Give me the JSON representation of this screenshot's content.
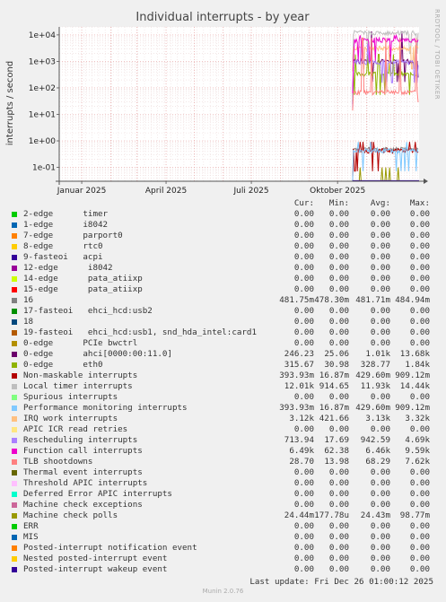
{
  "chart_data": {
    "type": "line",
    "title": "Individual interrupts - by year",
    "ylabel": "interrupts / second",
    "yscale": "log",
    "ylim": [
      0.03,
      20000
    ],
    "yticks": [
      "1e+04",
      "1e+03",
      "1e+02",
      "1e+01",
      "1e+00",
      "1e-01"
    ],
    "xlim": [
      "2024-12-08",
      "2025-12-27"
    ],
    "xticks": [
      {
        "label": "Januar 2025",
        "date": "2025-01-01"
      },
      {
        "label": "April 2025",
        "date": "2025-04-01"
      },
      {
        "label": "Juli 2025",
        "date": "2025-07-01"
      },
      {
        "label": "Oktober 2025",
        "date": "2025-10-01"
      }
    ],
    "grid": true,
    "legend": "bottom",
    "series_data_start": "2025-10-17",
    "series": [
      {
        "name": "2-edge      timer",
        "color": "#00cc00",
        "cur": "0.00",
        "min": "0.00",
        "avg": "0.00",
        "max": "0.00"
      },
      {
        "name": "1-edge      i8042",
        "color": "#0066b3",
        "cur": "0.00",
        "min": "0.00",
        "avg": "0.00",
        "max": "0.00"
      },
      {
        "name": "7-edge      parport0",
        "color": "#ff8000",
        "cur": "0.00",
        "min": "0.00",
        "avg": "0.00",
        "max": "0.00"
      },
      {
        "name": "8-edge      rtc0",
        "color": "#ffcc00",
        "cur": "0.00",
        "min": "0.00",
        "avg": "0.00",
        "max": "0.00"
      },
      {
        "name": "9-fasteoi   acpi",
        "color": "#330099",
        "cur": "0.00",
        "min": "0.00",
        "avg": "0.00",
        "max": "0.00"
      },
      {
        "name": "12-edge      i8042",
        "color": "#990099",
        "cur": "0.00",
        "min": "0.00",
        "avg": "0.00",
        "max": "0.00"
      },
      {
        "name": "14-edge      pata_atiixp",
        "color": "#ccff00",
        "cur": "0.00",
        "min": "0.00",
        "avg": "0.00",
        "max": "0.00"
      },
      {
        "name": "15-edge      pata_atiixp",
        "color": "#ff0000",
        "cur": "0.00",
        "min": "0.00",
        "avg": "0.00",
        "max": "0.00"
      },
      {
        "name": "16",
        "color": "#808080",
        "cur": "481.75m",
        "min": "478.30m",
        "avg": "481.71m",
        "max": "484.94m"
      },
      {
        "name": "17-fasteoi   ehci_hcd:usb2",
        "color": "#008f00",
        "cur": "0.00",
        "min": "0.00",
        "avg": "0.00",
        "max": "0.00"
      },
      {
        "name": "18",
        "color": "#00487d",
        "cur": "0.00",
        "min": "0.00",
        "avg": "0.00",
        "max": "0.00"
      },
      {
        "name": "19-fasteoi   ehci_hcd:usb1, snd_hda_intel:card1",
        "color": "#b35a00",
        "cur": "0.00",
        "min": "0.00",
        "avg": "0.00",
        "max": "0.00"
      },
      {
        "name": "0-edge      PCIe bwctrl",
        "color": "#b38f00",
        "cur": "0.00",
        "min": "0.00",
        "avg": "0.00",
        "max": "0.00"
      },
      {
        "name": "0-edge      ahci[0000:00:11.0]",
        "color": "#6b006b",
        "cur": "246.23",
        "min": "25.06",
        "avg": "1.01k",
        "max": "13.68k"
      },
      {
        "name": "0-edge      eth0",
        "color": "#8fb300",
        "cur": "315.67",
        "min": "30.98",
        "avg": "328.77",
        "max": "1.84k"
      },
      {
        "name": "Non-maskable interrupts",
        "color": "#b30000",
        "cur": "393.93m",
        "min": "16.87m",
        "avg": "429.60m",
        "max": "909.12m"
      },
      {
        "name": "Local timer interrupts",
        "color": "#bebebe",
        "cur": "12.01k",
        "min": "914.65",
        "avg": "11.93k",
        "max": "14.44k"
      },
      {
        "name": "Spurious interrupts",
        "color": "#80ff80",
        "cur": "0.00",
        "min": "0.00",
        "avg": "0.00",
        "max": "0.00"
      },
      {
        "name": "Performance monitoring interrupts",
        "color": "#80c9ff",
        "cur": "393.93m",
        "min": "16.87m",
        "avg": "429.60m",
        "max": "909.12m"
      },
      {
        "name": "IRQ work interrupts",
        "color": "#ffc080",
        "cur": "3.12k",
        "min": "421.66",
        "avg": "3.13k",
        "max": "3.32k"
      },
      {
        "name": "APIC ICR read retries",
        "color": "#ffe680",
        "cur": "0.00",
        "min": "0.00",
        "avg": "0.00",
        "max": "0.00"
      },
      {
        "name": "Rescheduling interrupts",
        "color": "#aa80ff",
        "cur": "713.94",
        "min": "17.69",
        "avg": "942.59",
        "max": "4.69k"
      },
      {
        "name": "Function call interrupts",
        "color": "#ee00cc",
        "cur": "6.49k",
        "min": "62.38",
        "avg": "6.46k",
        "max": "9.59k"
      },
      {
        "name": "TLB shootdowns",
        "color": "#ff8080",
        "cur": "28.70",
        "min": "13.98",
        "avg": "68.29",
        "max": "7.62k"
      },
      {
        "name": "Thermal event interrupts",
        "color": "#666600",
        "cur": "0.00",
        "min": "0.00",
        "avg": "0.00",
        "max": "0.00"
      },
      {
        "name": "Threshold APIC interrupts",
        "color": "#ffbfff",
        "cur": "0.00",
        "min": "0.00",
        "avg": "0.00",
        "max": "0.00"
      },
      {
        "name": "Deferred Error APIC interrupts",
        "color": "#00ffcc",
        "cur": "0.00",
        "min": "0.00",
        "avg": "0.00",
        "max": "0.00"
      },
      {
        "name": "Machine check exceptions",
        "color": "#cc6699",
        "cur": "0.00",
        "min": "0.00",
        "avg": "0.00",
        "max": "0.00"
      },
      {
        "name": "Machine check polls",
        "color": "#999900",
        "cur": "24.44m",
        "min": "177.78u",
        "avg": "24.43m",
        "max": "98.77m"
      },
      {
        "name": "ERR",
        "color": "#00cc00",
        "cur": "0.00",
        "min": "0.00",
        "avg": "0.00",
        "max": "0.00"
      },
      {
        "name": "MIS",
        "color": "#0066b3",
        "cur": "0.00",
        "min": "0.00",
        "avg": "0.00",
        "max": "0.00"
      },
      {
        "name": "Posted-interrupt notification event",
        "color": "#ff8000",
        "cur": "0.00",
        "min": "0.00",
        "avg": "0.00",
        "max": "0.00"
      },
      {
        "name": "Nested posted-interrupt event",
        "color": "#ffcc00",
        "cur": "0.00",
        "min": "0.00",
        "avg": "0.00",
        "max": "0.00"
      },
      {
        "name": "Posted-interrupt wakeup event",
        "color": "#330099",
        "cur": "0.00",
        "min": "0.00",
        "avg": "0.00",
        "max": "0.00"
      }
    ]
  },
  "legend_headers": {
    "cur": "Cur:",
    "min": "Min:",
    "avg": "Avg:",
    "max": "Max:"
  },
  "last_update": "Last update: Fri Dec 26 01:00:12 2025",
  "side_label": "RRDTOOL / TOBI OETIKER",
  "footer": "Munin 2.0.76"
}
